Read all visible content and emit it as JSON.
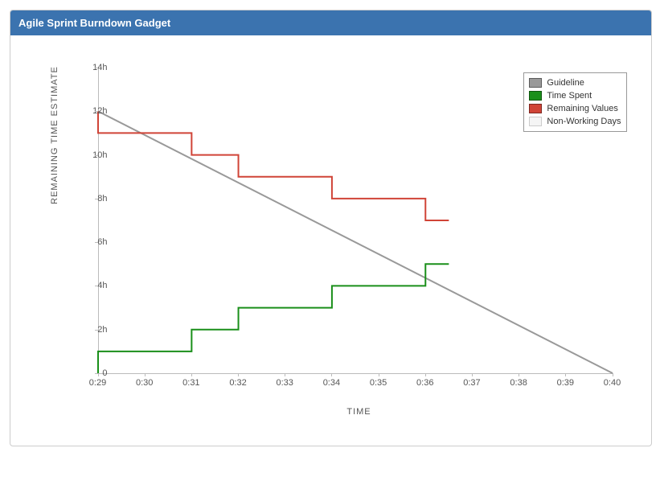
{
  "header": {
    "title": "Agile Sprint Burndown Gadget"
  },
  "chart_data": {
    "type": "line",
    "title": "",
    "xlabel": "TIME",
    "ylabel": "REMAINING TIME ESTIMATE",
    "x_categories": [
      "0:29",
      "0:30",
      "0:31",
      "0:32",
      "0:33",
      "0:34",
      "0:35",
      "0:36",
      "0:37",
      "0:38",
      "0:39",
      "0:40"
    ],
    "y_ticks": [
      0,
      "2h",
      "4h",
      "6h",
      "8h",
      "10h",
      "12h",
      "14h"
    ],
    "ylim": [
      0,
      14
    ],
    "xlim": [
      29,
      40
    ],
    "series": [
      {
        "name": "Guideline",
        "color": "#999999",
        "style": "line",
        "points": [
          {
            "x": 29,
            "y": 12
          },
          {
            "x": 40,
            "y": 0
          }
        ]
      },
      {
        "name": "Time Spent",
        "color": "#1a8f1a",
        "style": "step",
        "points": [
          {
            "x": 29,
            "y": 0
          },
          {
            "x": 29,
            "y": 1
          },
          {
            "x": 31,
            "y": 1
          },
          {
            "x": 31,
            "y": 2
          },
          {
            "x": 32,
            "y": 2
          },
          {
            "x": 32,
            "y": 3
          },
          {
            "x": 34,
            "y": 3
          },
          {
            "x": 34,
            "y": 4
          },
          {
            "x": 36,
            "y": 4
          },
          {
            "x": 36,
            "y": 5
          },
          {
            "x": 36.5,
            "y": 5
          }
        ]
      },
      {
        "name": "Remaining Values",
        "color": "#d04437",
        "style": "step",
        "points": [
          {
            "x": 29,
            "y": 12
          },
          {
            "x": 29,
            "y": 11
          },
          {
            "x": 31,
            "y": 11
          },
          {
            "x": 31,
            "y": 10
          },
          {
            "x": 32,
            "y": 10
          },
          {
            "x": 32,
            "y": 9
          },
          {
            "x": 34,
            "y": 9
          },
          {
            "x": 34,
            "y": 8
          },
          {
            "x": 36,
            "y": 8
          },
          {
            "x": 36,
            "y": 7
          },
          {
            "x": 36.5,
            "y": 7
          }
        ]
      },
      {
        "name": "Non-Working Days",
        "color": "#f5f5f5",
        "style": "area",
        "points": []
      }
    ],
    "legend": {
      "position": "top-right",
      "items": [
        "Guideline",
        "Time Spent",
        "Remaining Values",
        "Non-Working Days"
      ]
    }
  }
}
